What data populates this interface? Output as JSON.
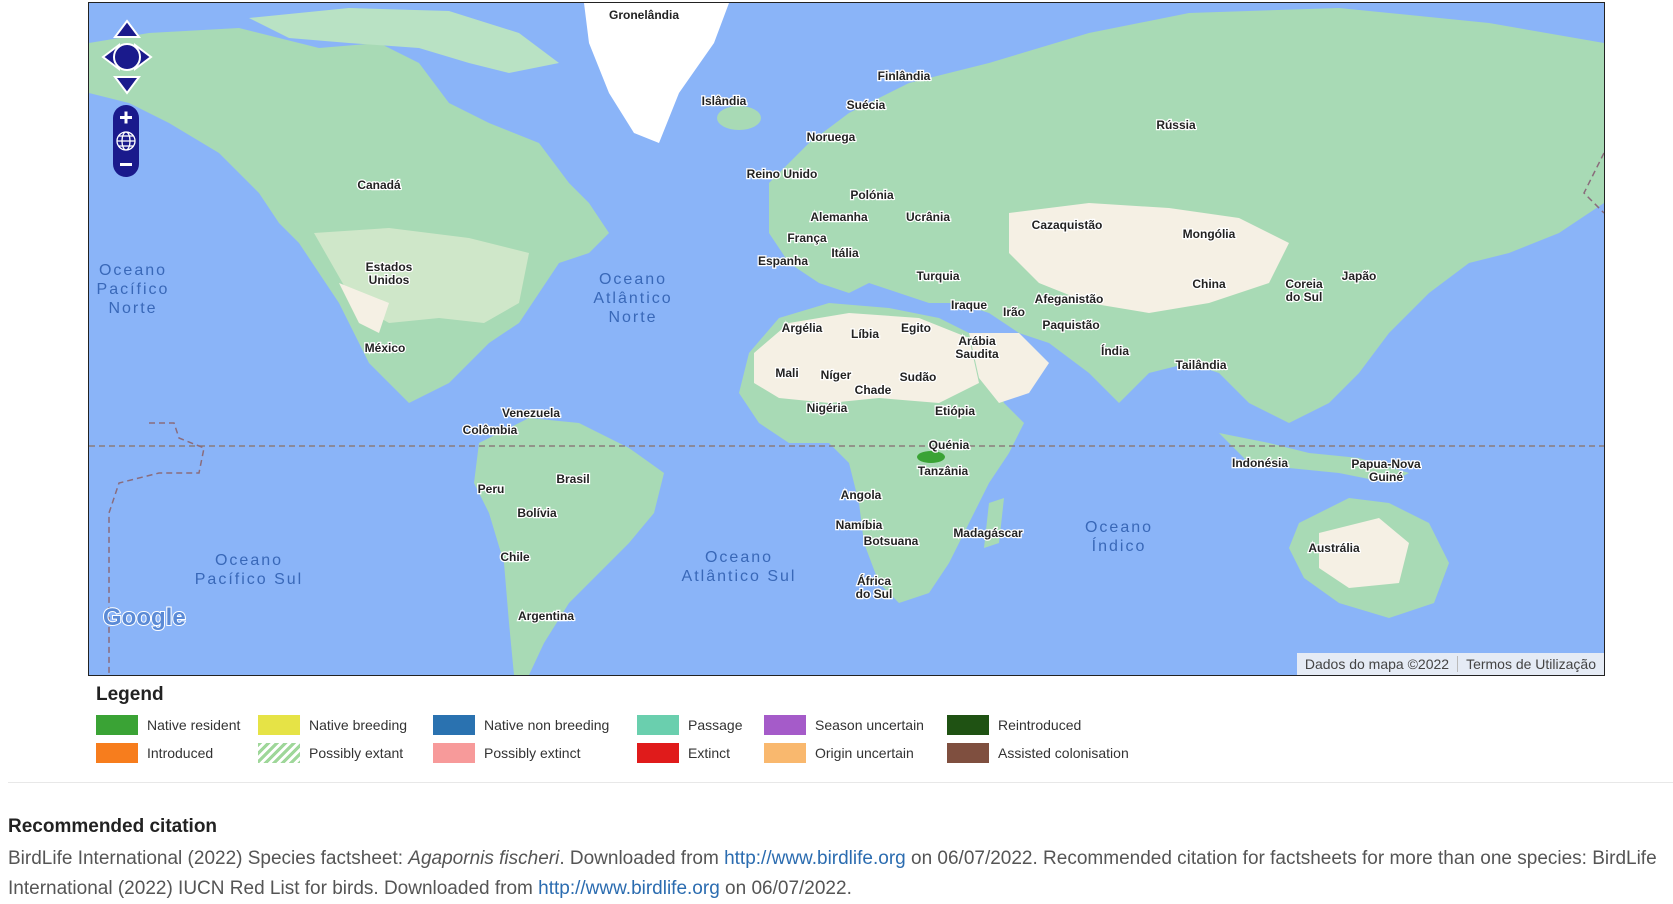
{
  "map": {
    "labels": {
      "gronelandia": "Gronelândia",
      "islandia": "Islândia",
      "finlandia": "Finlândia",
      "suecia": "Suécia",
      "noruega": "Noruega",
      "russia": "Rússia",
      "reino_unido": "Reino Unido",
      "polonia": "Polónia",
      "alemanha": "Alemanha",
      "ucrania": "Ucrânia",
      "franca": "França",
      "italia": "Itália",
      "espanha": "Espanha",
      "cazaquistao": "Cazaquistão",
      "mongolia": "Mongólia",
      "turquia": "Turquia",
      "iraque": "Iraque",
      "irao": "Irão",
      "afeganistao": "Afeganistão",
      "paquistao": "Paquistão",
      "china": "China",
      "coreia_1": "Coreia",
      "coreia_2": "do Sul",
      "japao": "Japão",
      "arabia_1": "Arábia",
      "arabia_2": "Saudita",
      "india": "Índia",
      "tailandia": "Tailândia",
      "canada": "Canadá",
      "eua_1": "Estados",
      "eua_2": "Unidos",
      "mexico": "México",
      "argelia": "Argélia",
      "libia": "Líbia",
      "egito": "Egito",
      "mali": "Mali",
      "niger": "Níger",
      "chade": "Chade",
      "sudao": "Sudão",
      "nigeria": "Nigéria",
      "etiopia": "Etiópia",
      "quenia": "Quénia",
      "tanzania": "Tanzânia",
      "angola": "Angola",
      "namibia": "Namíbia",
      "botsuana": "Botsuana",
      "africa_1": "África",
      "africa_2": "do Sul",
      "madagascar": "Madagáscar",
      "venezuela": "Venezuela",
      "colombia": "Colômbia",
      "brasil": "Brasil",
      "peru": "Peru",
      "bolivia": "Bolívia",
      "chile": "Chile",
      "argentina": "Argentina",
      "indonesia": "Indonésia",
      "papua_1": "Papua-Nova",
      "papua_2": "Guiné",
      "australia": "Austrália"
    },
    "oceans": {
      "pac_norte_1": "Oceano",
      "pac_norte_2": "Pacífico",
      "pac_norte_3": "Norte",
      "atl_norte_1": "Oceano",
      "atl_norte_2": "Atlântico",
      "atl_norte_3": "Norte",
      "pac_sul_1": "Oceano",
      "pac_sul_2": "Pacífico Sul",
      "atl_sul_1": "Oceano",
      "atl_sul_2": "Atlântico Sul",
      "indico_1": "Oceano",
      "indico_2": "Índico"
    },
    "attribution": "Dados do mapa ©2022",
    "terms": "Termos de Utilização",
    "google_logo": "Google",
    "colors": {
      "water": "#8ab4f8",
      "land": "#a8dab5",
      "desert": "#f5f0e4",
      "control": "#1a1a8c"
    }
  },
  "legend": {
    "title": "Legend",
    "row1": [
      {
        "label": "Native resident",
        "color": "#3aa335"
      },
      {
        "label": "Native breeding",
        "color": "#e6e346"
      },
      {
        "label": "Native non breeding",
        "color": "#2a72b0"
      },
      {
        "label": "Passage",
        "color": "#6acfae"
      },
      {
        "label": "Season uncertain",
        "color": "#a55bc9"
      },
      {
        "label": "Reintroduced",
        "color": "#1f5213"
      }
    ],
    "row2": [
      {
        "label": "Introduced",
        "color": "#f77d1d"
      },
      {
        "label": "Possibly extant",
        "color": "hatched-green"
      },
      {
        "label": "Possibly extinct",
        "color": "#f79a9a"
      },
      {
        "label": "Extinct",
        "color": "#e01b1b"
      },
      {
        "label": "Origin uncertain",
        "color": "#f9b86e"
      },
      {
        "label": "Assisted colonisation",
        "color": "#7f4f3f"
      }
    ]
  },
  "citation": {
    "title": "Recommended citation",
    "part1": "BirdLife International (2022) Species factsheet: ",
    "species": "Agapornis fischeri",
    "part2": ". Downloaded from ",
    "link1": "http://www.birdlife.org",
    "part3": " on 06/07/2022. Recommended citation for factsheets for more than one species: BirdLife International (2022) IUCN Red List for birds. Downloaded from ",
    "link2": "http://www.birdlife.org",
    "part4": " on 06/07/2022."
  }
}
